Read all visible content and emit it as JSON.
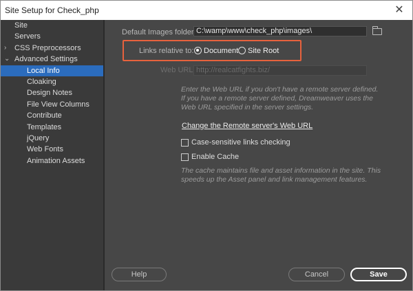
{
  "window": {
    "title": "Site Setup for Check_php",
    "close_glyph": "✕"
  },
  "sidebar": {
    "items": [
      {
        "label": "Site",
        "level": "top"
      },
      {
        "label": "Servers",
        "level": "top"
      },
      {
        "label": "CSS Preprocessors",
        "level": "top",
        "expander": "›"
      },
      {
        "label": "Advanced Settings",
        "level": "top",
        "expander": "⌄"
      },
      {
        "label": "Local Info",
        "level": "child",
        "selected": true
      },
      {
        "label": "Cloaking",
        "level": "child"
      },
      {
        "label": "Design Notes",
        "level": "child"
      },
      {
        "label": "File View Columns",
        "level": "child"
      },
      {
        "label": "Contribute",
        "level": "child"
      },
      {
        "label": "Templates",
        "level": "child"
      },
      {
        "label": "jQuery",
        "level": "child"
      },
      {
        "label": "Web Fonts",
        "level": "child"
      },
      {
        "label": "Animation Assets",
        "level": "child"
      }
    ]
  },
  "local_info": {
    "default_images_label": "Default Images folder:",
    "default_images_value": "C:\\wamp\\www\\check_php\\images\\",
    "links_relative_label": "Links relative to:",
    "radio_document": "Document",
    "radio_site_root": "Site Root",
    "selected_radio": "Document",
    "web_url_label": "Web URL:",
    "web_url_value": "http://realcatfights.biz/",
    "web_url_note": "Enter the Web URL if you don't have a remote server defined. If you have a remote server defined, Dreamweaver uses the Web URL specified in the server settings.",
    "change_remote_link": "Change the Remote server's Web URL",
    "case_sensitive_label": "Case-sensitive links checking",
    "case_sensitive_checked": false,
    "enable_cache_label": "Enable Cache",
    "enable_cache_checked": false,
    "cache_note": "The cache maintains file and asset information in the site. This speeds up the Asset panel and link management features."
  },
  "buttons": {
    "help": "Help",
    "cancel": "Cancel",
    "save": "Save"
  },
  "colors": {
    "highlight_border": "#e8623d",
    "selected_item": "#2b6cbd",
    "panel_bg": "#474747"
  }
}
